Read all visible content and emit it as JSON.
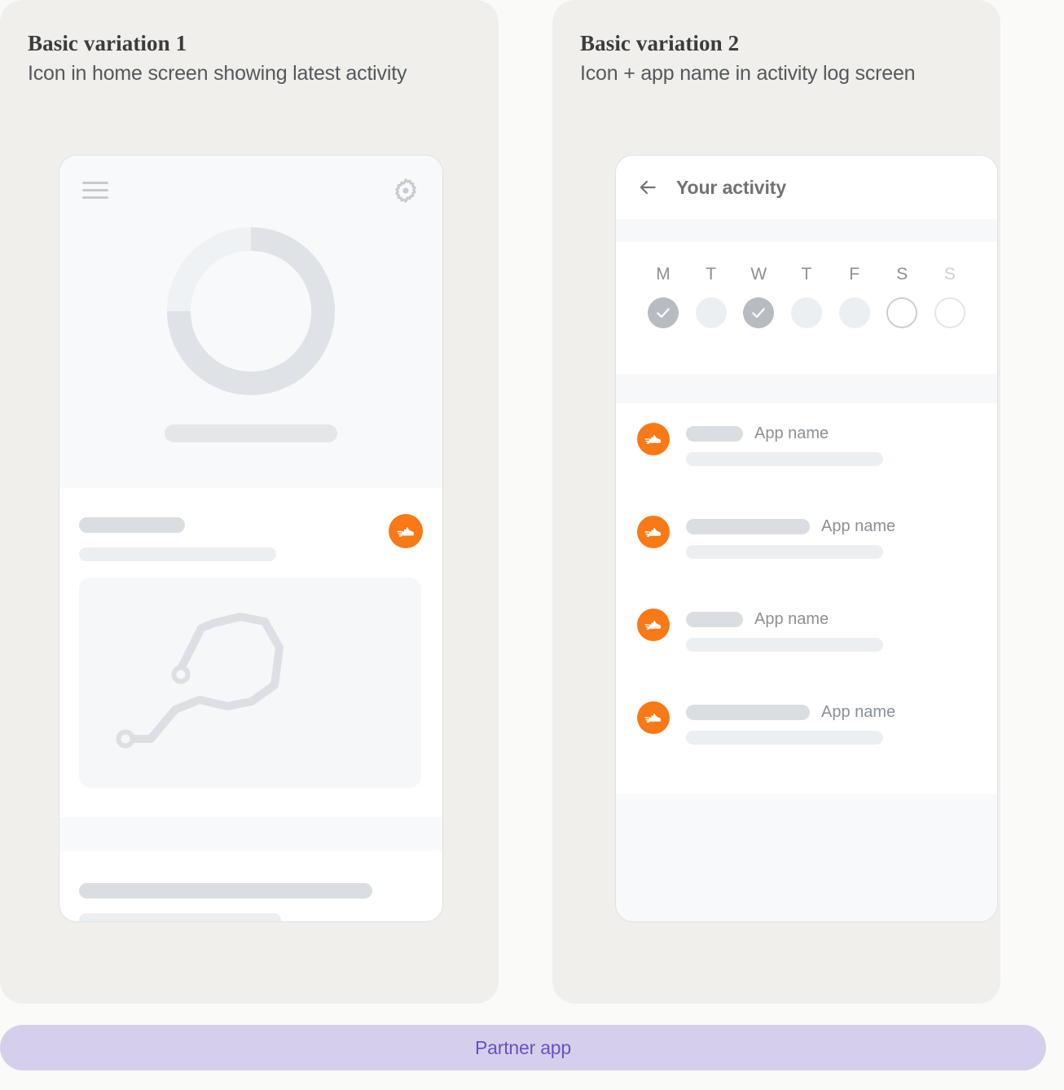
{
  "page": {
    "background_color": "#FAFAF8",
    "panel_color": "#F0EFEC"
  },
  "panels": [
    {
      "id": "variation-1",
      "title": "Basic variation 1",
      "subtitle": "Icon in home screen showing latest activity"
    },
    {
      "id": "variation-2",
      "title": "Basic variation 2",
      "subtitle": "Icon + app name in activity log screen"
    }
  ],
  "variation_1": {
    "icons": {
      "menu": "hamburger-menu-icon",
      "settings": "gear-icon",
      "activity": "running-shoe-icon",
      "map": "route-map-illustration"
    },
    "progress_ring": {
      "track_color": "#DFE2E6",
      "remainder_color": "#EFF2F4",
      "filled_percent": 75
    },
    "accent_color": "#F97916",
    "placeholder_color": "#DADDE1",
    "placeholder_light_color": "#ECEFF1"
  },
  "variation_2": {
    "header": {
      "back_icon": "back-arrow-icon",
      "title": "Your activity"
    },
    "week": {
      "day_labels": [
        "M",
        "T",
        "W",
        "T",
        "F",
        "S",
        "S"
      ],
      "day_states": [
        "checked",
        "filled",
        "checked",
        "filled",
        "filled",
        "outline",
        "outline-faint"
      ],
      "checked_color": "#B6BCC2",
      "filled_color": "#ECEFF1",
      "outline_color": "#C9CED3"
    },
    "log_rows": [
      {
        "icon": "running-shoe-icon",
        "bar": "short",
        "app_name": "App name",
        "order": "bar-first"
      },
      {
        "icon": "running-shoe-icon",
        "bar": "long",
        "app_name": "App name",
        "order": "bar-first"
      },
      {
        "icon": "running-shoe-icon",
        "bar": "short",
        "app_name": "App name",
        "order": "bar-first"
      },
      {
        "icon": "running-shoe-icon",
        "bar": "long",
        "app_name": "App name",
        "order": "bar-first"
      }
    ],
    "accent_color": "#F97916"
  },
  "footer": {
    "label": "Partner app",
    "background_color": "#D6CFEC",
    "text_color": "#6A4FC4"
  }
}
